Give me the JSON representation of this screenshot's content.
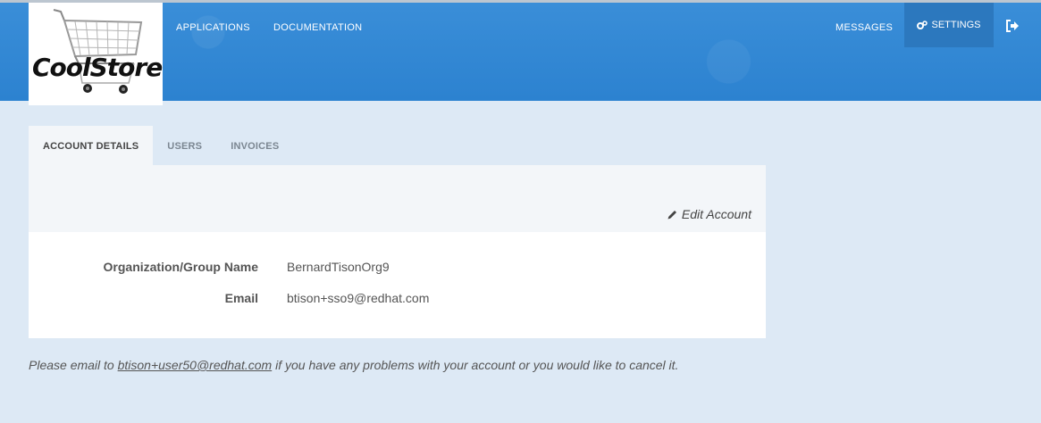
{
  "brand": {
    "logo_text": "CoolStore"
  },
  "nav": {
    "applications": "APPLICATIONS",
    "documentation": "DOCUMENTATION",
    "messages": "MESSAGES",
    "settings": "SETTINGS"
  },
  "tabs": [
    {
      "label": "ACCOUNT DETAILS",
      "active": true
    },
    {
      "label": "USERS",
      "active": false
    },
    {
      "label": "INVOICES",
      "active": false
    }
  ],
  "panel": {
    "edit_label": "Edit Account",
    "fields": [
      {
        "label": "Organization/Group Name",
        "value": "BernardTisonOrg9"
      },
      {
        "label": "Email",
        "value": "btison+sso9@redhat.com"
      }
    ]
  },
  "footer": {
    "prefix": "Please email to ",
    "email": "btison+user50@redhat.com",
    "suffix": " if you have any problems with your account or you would like to cancel it."
  },
  "colors": {
    "header": "#2f86d3",
    "page_bg": "#dde9f5",
    "panel_bg": "#f3f6f9"
  }
}
